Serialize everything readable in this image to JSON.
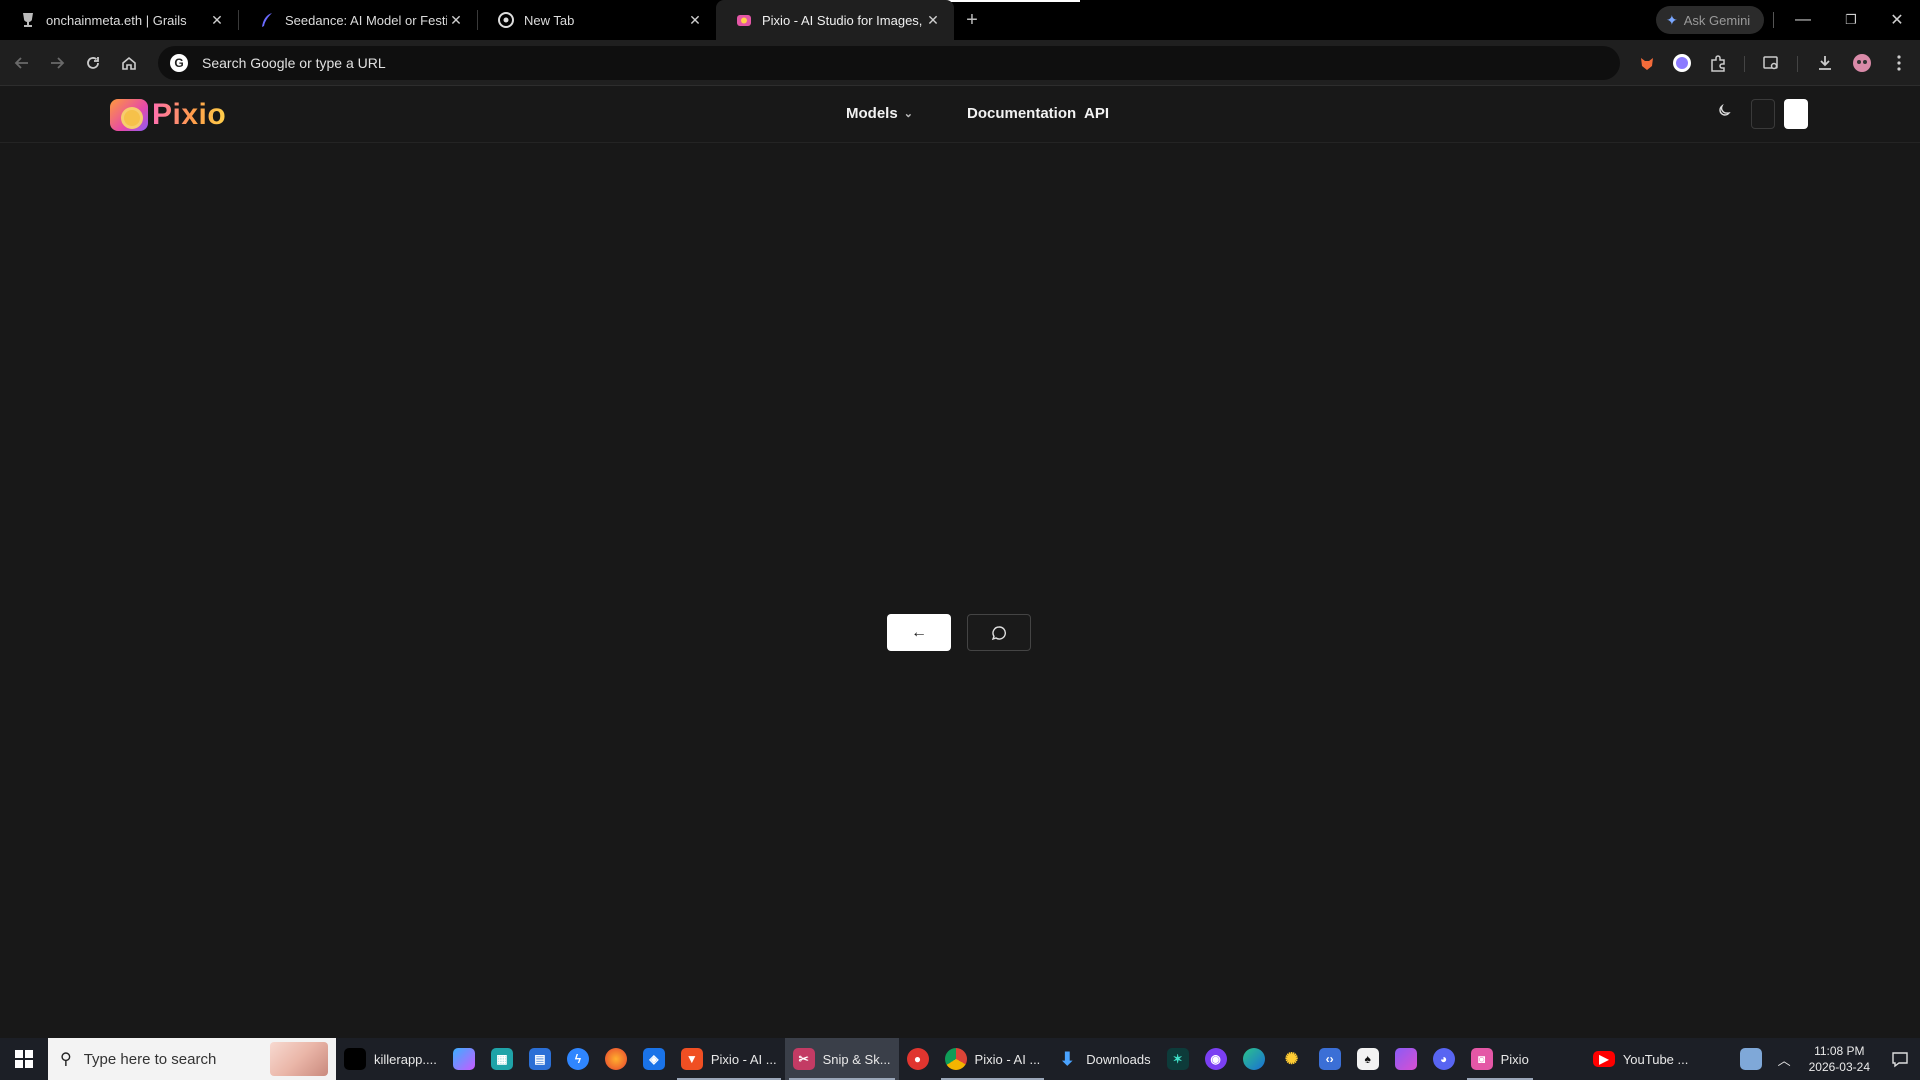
{
  "browser": {
    "tabs": [
      {
        "title": "onchainmeta.eth | Grails",
        "icon": "grails-icon"
      },
      {
        "title": "Seedance: AI Model or Festival?",
        "icon": "feather-icon"
      },
      {
        "title": "New Tab",
        "icon": "chrome-icon"
      },
      {
        "title": "Pixio - AI Studio for Images, Vid",
        "icon": "pixio-icon",
        "active": true
      }
    ],
    "new_tab_symbol": "+",
    "ask_gemini": "Ask Gemini",
    "omnibox_placeholder": "Search Google or type a URL",
    "window_controls": {
      "minimize": "—",
      "restore": "❐",
      "close": "✕"
    }
  },
  "site": {
    "logo_text": "Pixio",
    "nav": {
      "models": "Models",
      "documentation": "Documentation",
      "api": "API"
    },
    "theme_icon": "moon-icon",
    "center_buttons": {
      "back_symbol": "←",
      "chat_symbol": "💬"
    }
  },
  "taskbar": {
    "search_placeholder": "Type here to search",
    "items": [
      {
        "label": "killerapp....",
        "icon": "app-icon"
      },
      {
        "label": "",
        "icon": "copilot-icon"
      },
      {
        "label": "",
        "icon": "calculator-icon"
      },
      {
        "label": "",
        "icon": "store-icon"
      },
      {
        "label": "",
        "icon": "messenger-icon"
      },
      {
        "label": "",
        "icon": "firefox-icon"
      },
      {
        "label": "",
        "icon": "shield-icon"
      },
      {
        "label": "Pixio - AI ...",
        "icon": "brave-icon"
      },
      {
        "label": "Snip & Sk...",
        "icon": "snip-icon"
      },
      {
        "label": "",
        "icon": "record-icon"
      },
      {
        "label": "Pixio - AI ...",
        "icon": "chrome-icon"
      },
      {
        "label": "Downloads",
        "icon": "download-icon"
      },
      {
        "label": "",
        "icon": "game-icon"
      },
      {
        "label": "",
        "icon": "mask-icon"
      },
      {
        "label": "",
        "icon": "edge-icon"
      },
      {
        "label": "",
        "icon": "party-icon"
      },
      {
        "label": "",
        "icon": "code-icon"
      },
      {
        "label": "",
        "icon": "cards-icon"
      },
      {
        "label": "",
        "icon": "folder-icon"
      },
      {
        "label": "",
        "icon": "discord-icon"
      },
      {
        "label": "Pixio",
        "icon": "pixio-icon"
      },
      {
        "label": "YouTube ...",
        "icon": "youtube-icon"
      }
    ],
    "time": "11:08 PM",
    "date": "2026-03-24"
  },
  "colors": {
    "page_bg": "#181818",
    "tabstrip_bg": "#000000",
    "taskbar_bg": "#1c1f26"
  }
}
